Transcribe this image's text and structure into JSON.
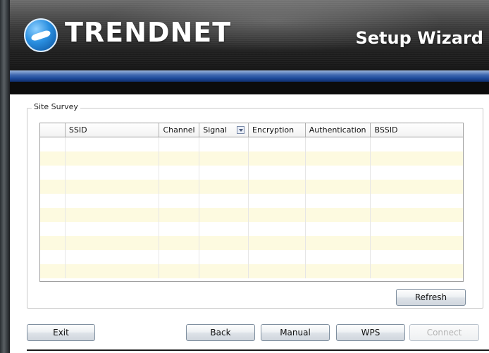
{
  "header": {
    "brand": "TRENDNET",
    "title": "Setup Wizard"
  },
  "site_survey": {
    "group_label": "Site Survey",
    "columns": [
      "",
      "SSID",
      "Channel",
      "Signal",
      "Encryption",
      "Authentication",
      "BSSID"
    ],
    "row_count": 10
  },
  "buttons": {
    "refresh": "Refresh",
    "exit": "Exit",
    "back": "Back",
    "manual": "Manual",
    "wps": "WPS",
    "connect": "Connect"
  },
  "colors": {
    "row_alt": "#fdfae0",
    "accent_blue": "#1e4a9a"
  }
}
